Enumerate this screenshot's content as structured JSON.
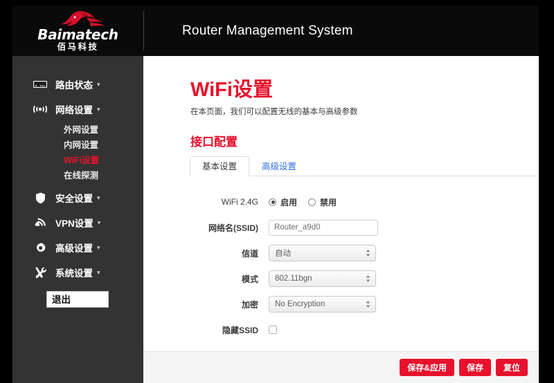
{
  "brand": {
    "name_en": "Baimatech",
    "name_cn": "佰马科技",
    "logo_icon": "horse-head-icon",
    "accent_red": "#e8112d"
  },
  "header": {
    "title": "Router Management System"
  },
  "sidebar": {
    "items": [
      {
        "label": "路由状态",
        "icon": "router-icon",
        "caret": "▾",
        "active": false,
        "children": []
      },
      {
        "label": "网络设置",
        "icon": "broadcast-icon",
        "caret": "▾",
        "active": true,
        "children": [
          {
            "label": "外网设置",
            "active": false
          },
          {
            "label": "内网设置",
            "active": false
          },
          {
            "label": "WiFi设置",
            "active": true
          },
          {
            "label": "在线探测",
            "active": false
          }
        ]
      },
      {
        "label": "安全设置",
        "icon": "shield-icon",
        "caret": "▾",
        "active": false,
        "children": []
      },
      {
        "label": "VPN设置",
        "icon": "signal-wave-icon",
        "caret": "▾",
        "active": false,
        "children": []
      },
      {
        "label": "高级设置",
        "icon": "gear-icon",
        "caret": "▾",
        "active": false,
        "children": []
      },
      {
        "label": "系统设置",
        "icon": "tools-icon",
        "caret": "▾",
        "active": false,
        "children": []
      }
    ],
    "logout_label": "退出"
  },
  "main": {
    "page_title": "WiFi设置",
    "page_subtitle": "在本页面，我们可以配置无线的基本与高级参数",
    "section_title": "接口配置",
    "tabs": [
      {
        "label": "基本设置",
        "active": true
      },
      {
        "label": "高级设置",
        "active": false
      }
    ],
    "form": {
      "wifi24": {
        "label": "WiFi 2.4G",
        "options": [
          {
            "label": "启用",
            "selected": true
          },
          {
            "label": "禁用",
            "selected": false
          }
        ]
      },
      "ssid": {
        "label": "网络名(SSID)",
        "value": "Router_a9d0",
        "placeholder": "Router_a9d0"
      },
      "channel": {
        "label": "信道",
        "value": "自动",
        "options": [
          "自动"
        ]
      },
      "mode": {
        "label": "模式",
        "value": "802.11bgn",
        "options": [
          "802.11bgn"
        ]
      },
      "encryption": {
        "label": "加密",
        "value": "No Encryption",
        "options": [
          "No Encryption"
        ]
      },
      "hide_ssid": {
        "label": "隐藏SSID",
        "checked": false
      }
    }
  },
  "footer": {
    "buttons": [
      {
        "label": "保存&应用"
      },
      {
        "label": "保存"
      },
      {
        "label": "复位"
      }
    ]
  }
}
